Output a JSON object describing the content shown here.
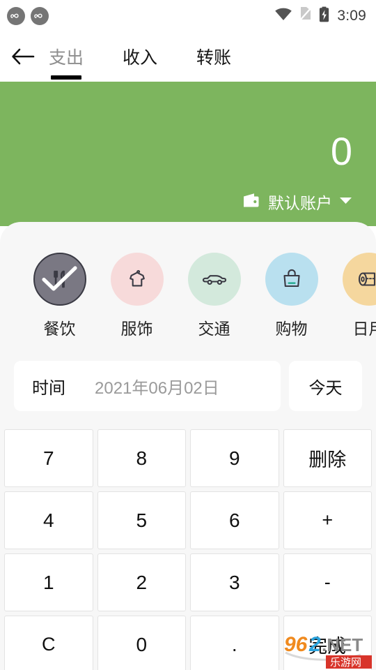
{
  "statusbar": {
    "notifications": [
      {
        "icon": "app-notification-icon"
      },
      {
        "icon": "app-notification-icon"
      }
    ],
    "wifi_icon": "wifi-icon",
    "sim_icon": "no-sim-icon",
    "battery_icon": "battery-charging-icon",
    "time": "3:09"
  },
  "topbar": {
    "back_icon": "back-arrow-icon",
    "tabs": [
      {
        "label": "支出",
        "active": true
      },
      {
        "label": "收入",
        "active": false
      },
      {
        "label": "转账",
        "active": false
      }
    ]
  },
  "hero": {
    "amount": "0",
    "wallet_icon": "wallet-icon",
    "account_name": "默认账户",
    "dropdown_icon": "chevron-down-icon",
    "background_color": "#7db55e"
  },
  "categories": [
    {
      "label": "餐饮",
      "icon": "dining-icon",
      "color": "#7a7883",
      "selected": true
    },
    {
      "label": "服饰",
      "icon": "clothing-icon",
      "color": "#f7dada",
      "selected": false
    },
    {
      "label": "交通",
      "icon": "car-icon",
      "color": "#d3e9dc",
      "selected": false
    },
    {
      "label": "购物",
      "icon": "shopping-bag-icon",
      "color": "#b9e0ef",
      "selected": false
    },
    {
      "label": "日用",
      "icon": "toilet-paper-icon",
      "color": "#f5d79e",
      "selected": false
    }
  ],
  "date_row": {
    "label": "时间",
    "value": "2021年06月02日",
    "today_label": "今天"
  },
  "keypad": [
    {
      "label": "7",
      "kind": "digit"
    },
    {
      "label": "8",
      "kind": "digit"
    },
    {
      "label": "9",
      "kind": "digit"
    },
    {
      "label": "删除",
      "kind": "op"
    },
    {
      "label": "4",
      "kind": "digit"
    },
    {
      "label": "5",
      "kind": "digit"
    },
    {
      "label": "6",
      "kind": "digit"
    },
    {
      "label": "+",
      "kind": "op"
    },
    {
      "label": "1",
      "kind": "digit"
    },
    {
      "label": "2",
      "kind": "digit"
    },
    {
      "label": "3",
      "kind": "digit"
    },
    {
      "label": "-",
      "kind": "op"
    },
    {
      "label": "C",
      "kind": "op"
    },
    {
      "label": "0",
      "kind": "digit"
    },
    {
      "label": ".",
      "kind": "digit"
    },
    {
      "label": "完成",
      "kind": "op"
    }
  ],
  "watermark": {
    "num_orange": "96",
    "num_blue": "2",
    "suffix": ".NET",
    "banner": "乐游网"
  }
}
